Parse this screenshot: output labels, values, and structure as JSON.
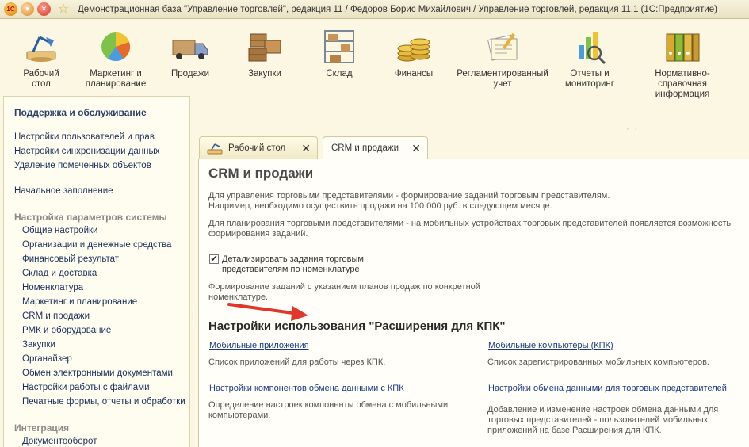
{
  "window": {
    "title": "Демонстрационная база \"Управление торговлей\", редакция 11 / Федоров Борис Михайлович / Управление торговлей, редакция 11.1  (1С:Предприятие)",
    "logo_text": "1С"
  },
  "sections": [
    {
      "label": "Рабочий\nстол",
      "icon": "desk-lamp-icon"
    },
    {
      "label": "Маркетинг и\nпланирование",
      "icon": "pie-chart-icon"
    },
    {
      "label": "Продажи",
      "icon": "truck-icon"
    },
    {
      "label": "Закупки",
      "icon": "crates-icon"
    },
    {
      "label": "Склад",
      "icon": "shelves-icon"
    },
    {
      "label": "Финансы",
      "icon": "coins-icon"
    },
    {
      "label": "Регламентированный\nучет",
      "icon": "documents-icon"
    },
    {
      "label": "Отчеты и\nмониторинг",
      "icon": "bar-chart-icon"
    },
    {
      "label": "Нормативно-справочная\nинформация",
      "icon": "binders-icon"
    }
  ],
  "left_panel": {
    "heading": "Поддержка и обслуживание",
    "top_links": [
      "Настройки пользователей и прав",
      "Настройки синхронизации данных",
      "Удаление помеченных объектов"
    ],
    "initial_fill": "Начальное заполнение",
    "group_settings": "Настройка параметров системы",
    "settings_links": [
      "Общие настройки",
      "Организации и денежные средства",
      "Финансовый результат",
      "Склад и доставка",
      "Номенклатура",
      "Маркетинг и планирование",
      "CRM и продажи",
      "РМК и оборудование",
      "Закупки",
      "Органайзер",
      "Обмен электронными документами",
      "Настройки работы с файлами",
      "Печатные формы, отчеты и обработки"
    ],
    "group_integration": "Интеграция",
    "integration_links": [
      "Документооборот"
    ]
  },
  "tabs": [
    {
      "label": "Рабочий стол",
      "close": "✕"
    },
    {
      "label": "CRM и продажи",
      "close": "✕"
    }
  ],
  "content": {
    "title": "CRM и продажи",
    "para1_line1": "Для управления торговыми представителями - формирование заданий торговым представителям.",
    "para1_line2": "Например, необходимо осуществить продажи на 100 000 руб. в следующем месяце.",
    "para2_line1": "Для планирования торговыми представителями - на мобильных устройствах торговых представителей появляется возможность",
    "para2_line2": "формирования заданий.",
    "checkbox_label_line1": "Детализировать задания торговым",
    "checkbox_label_line2": "представителям по номенклатуре",
    "checkbox_checked": "✔",
    "para3_line1": "Формирование заданий с указанием планов продаж по конкретной",
    "para3_line2": "номенклатуре.",
    "section_heading": "Настройки использования \"Расширения для КПК\"",
    "link_mobile_apps": "Мобильные приложения",
    "desc_mobile_apps": "Список приложений для работы через КПК.",
    "link_mobile_computers": "Мобильные компьютеры (КПК)",
    "desc_mobile_computers": "Список зарегистрированных мобильных компьютеров.",
    "link_exchange_components": "Настройки компонентов обмена данными с КПК",
    "desc_exchange_components_line1": "Определение настроек компоненты обмена с мобильными",
    "desc_exchange_components_line2": "компьютерами.",
    "link_exchange_reps": "Настройки обмена данными для торговых представителей",
    "desc_exchange_reps_line1": "Добавление и изменение настроек обмена данными для",
    "desc_exchange_reps_line2": "торговых представителей - пользователей мобильных",
    "desc_exchange_reps_line3": "приложений на базе Расширения для КПК."
  },
  "colors": {
    "arrow": "#e0372a",
    "link": "#1b3a82",
    "background": "#fbf7e2"
  }
}
